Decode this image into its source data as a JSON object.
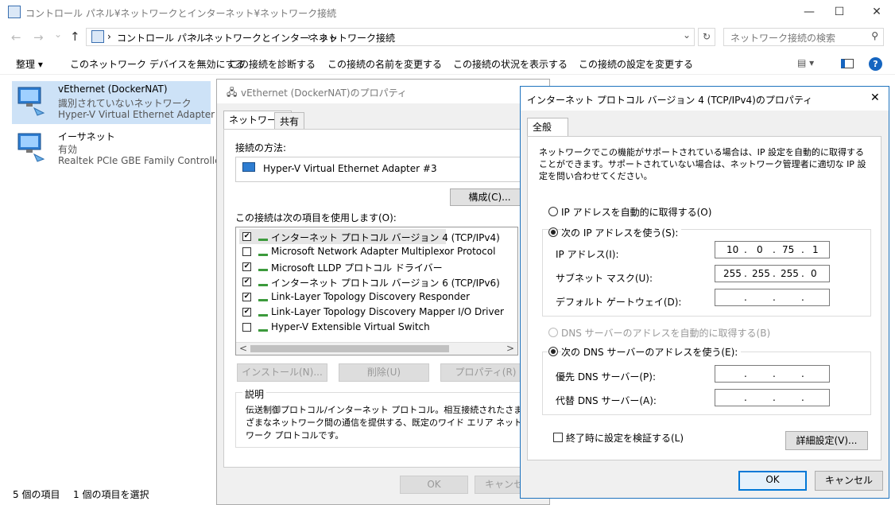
{
  "explorer": {
    "title": "コントロール パネル¥ネットワークとインターネット¥ネットワーク接続",
    "window_buttons": {
      "minimize": "—",
      "maximize": "☐",
      "close": "✕"
    },
    "nav": {
      "back": "←",
      "forward": "→",
      "recent": "⌄",
      "up": "↑"
    },
    "address": {
      "sep": "›",
      "crumbs": [
        "コントロール パネル",
        "ネットワークとインターネット",
        "ネットワーク接続"
      ],
      "dropdown": "⌄"
    },
    "refresh": "↻",
    "search_placeholder": "ネットワーク接続の検索",
    "commands": [
      "整理 ▾",
      "このネットワーク デバイスを無効にする",
      "この接続を診断する",
      "この接続の名前を変更する",
      "この接続の状況を表示する",
      "この接続の設定を変更する"
    ],
    "view_icon": "▤ ▾",
    "help": "?",
    "items": [
      {
        "name": "vEthernet (DockerNAT)",
        "status": "識別されていないネットワーク",
        "adapter": "Hyper-V Virtual Ethernet Adapter ..."
      },
      {
        "name": "イーサネット",
        "status": "有効",
        "adapter": "Realtek PCIe GBE Family Controller"
      }
    ],
    "status_count": "5 個の項目",
    "status_selected": "1 個の項目を選択"
  },
  "props": {
    "title": "vEthernet (DockerNAT)のプロパティ",
    "tabs": [
      "ネットワーク",
      "共有"
    ],
    "connect_using_label": "接続の方法:",
    "adapter": "Hyper-V Virtual Ethernet Adapter #3",
    "configure": "構成(C)...",
    "items_label": "この接続は次の項目を使用します(O):",
    "items": [
      {
        "label": "インターネット プロトコル バージョン 4 (TCP/IPv4)",
        "checked": "✔"
      },
      {
        "label": "Microsoft Network Adapter Multiplexor Protocol",
        "checked": ""
      },
      {
        "label": "Microsoft LLDP プロトコル ドライバー",
        "checked": "✔"
      },
      {
        "label": "インターネット プロトコル バージョン 6 (TCP/IPv6)",
        "checked": "✔"
      },
      {
        "label": "Link-Layer Topology Discovery Responder",
        "checked": "✔"
      },
      {
        "label": "Link-Layer Topology Discovery Mapper I/O Driver",
        "checked": "✔"
      },
      {
        "label": "Hyper-V Extensible Virtual Switch",
        "checked": ""
      }
    ],
    "scroll_left": "<",
    "scroll_right": ">",
    "install": "インストール(N)...",
    "uninstall": "削除(U)",
    "properties": "プロパティ(R)",
    "desc_label": "説明",
    "desc": "伝送制御プロトコル/インターネット プロトコル。相互接続されたさまざまなネットワーク間の通信を提供する、既定のワイド エリア ネットワーク プロトコルです。",
    "ok": "OK",
    "cancel": "キャンセル"
  },
  "ipv4": {
    "title": "インターネット プロトコル バージョン 4 (TCP/IPv4)のプロパティ",
    "close": "✕",
    "tab": "全般",
    "intro": "ネットワークでこの機能がサポートされている場合は、IP 設定を自動的に取得することができます。サポートされていない場合は、ネットワーク管理者に適切な IP 設定を問い合わせてください。",
    "auto_ip": "IP アドレスを自動的に取得する(O)",
    "manual_ip": "次の IP アドレスを使う(S):",
    "ip_label": "IP アドレス(I):",
    "ip": [
      "10",
      "0",
      "75",
      "1"
    ],
    "mask_label": "サブネット マスク(U):",
    "mask": [
      "255",
      "255",
      "255",
      "0"
    ],
    "gw_label": "デフォルト ゲートウェイ(D):",
    "dot": ".",
    "auto_dns": "DNS サーバーのアドレスを自動的に取得する(B)",
    "manual_dns": "次の DNS サーバーのアドレスを使う(E):",
    "pref_dns": "優先 DNS サーバー(P):",
    "alt_dns": "代替 DNS サーバー(A):",
    "validate": "終了時に設定を検証する(L)",
    "advanced": "詳細設定(V)...",
    "ok": "OK",
    "cancel": "キャンセル"
  }
}
